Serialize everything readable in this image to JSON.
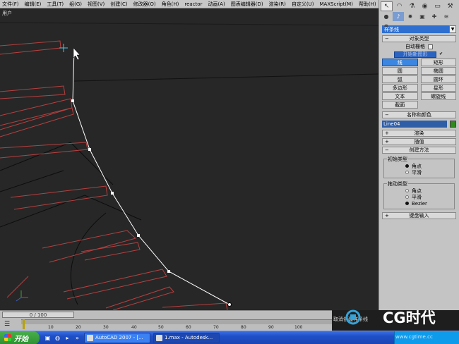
{
  "menu": [
    "文件(F)",
    "编辑(E)",
    "工具(T)",
    "组(G)",
    "视图(V)",
    "创建(C)",
    "修改器(O)",
    "角色(H)",
    "reactor",
    "动画(A)",
    "图表编辑器(D)",
    "渲染(R)",
    "自定义(U)",
    "MAXScript(M)",
    "帮助(H)"
  ],
  "viewport": {
    "label": "用户"
  },
  "panel": {
    "category": "样条线",
    "object_type": {
      "title": "对象类型",
      "autogrid_label": "自动栅格",
      "start_new_shape": "开始新图形",
      "buttons": [
        "线",
        "矩形",
        "圆",
        "椭圆",
        "弧",
        "圆环",
        "多边形",
        "星形",
        "文本",
        "螺旋线",
        "截面"
      ]
    },
    "name_color": {
      "title": "名称和颜色",
      "name": "Line04",
      "color": "#2f8a1c"
    },
    "rollouts": {
      "render": "渲染",
      "interp": "插值",
      "create_method": "创建方法",
      "keyboard": "键盘输入"
    },
    "initial_type": {
      "title": "初始类型",
      "options": [
        "角点",
        "平滑"
      ],
      "selected": 0
    },
    "drag_type": {
      "title": "拖动类型",
      "options": [
        "角点",
        "平滑",
        "Bezier"
      ],
      "selected": 2
    }
  },
  "time": {
    "slider": "0 / 100",
    "ticks": [
      "10",
      "20",
      "30",
      "40",
      "50",
      "60",
      "70",
      "80",
      "90",
      "100"
    ]
  },
  "status": {
    "message": "取消创建样条线"
  },
  "logo": {
    "text": "CG时代"
  },
  "taskbar": {
    "start": "开始",
    "tasks": [
      "AutoCAD 2007 - [...",
      "1.max - Autodesk..."
    ]
  },
  "watermark": "www.cgtime.cc"
}
